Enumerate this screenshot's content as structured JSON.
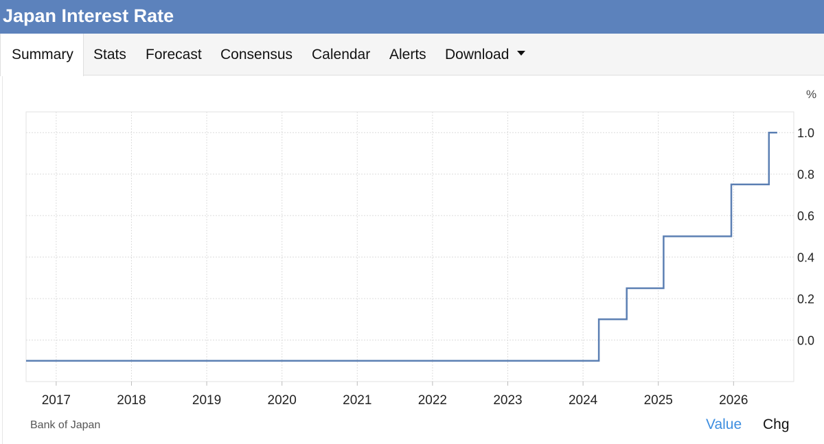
{
  "header": {
    "title": "Japan Interest Rate"
  },
  "tabs": [
    {
      "label": "Summary",
      "active": true
    },
    {
      "label": "Stats"
    },
    {
      "label": "Forecast"
    },
    {
      "label": "Consensus"
    },
    {
      "label": "Calendar"
    },
    {
      "label": "Alerts"
    },
    {
      "label": "Download",
      "dropdown": true
    }
  ],
  "footer": {
    "source": "Bank of Japan",
    "toggle_value": "Value",
    "toggle_chg": "Chg"
  },
  "colors": {
    "header_bg": "#5c82bc",
    "series_line": "#5b7fb3",
    "active_toggle": "#3d8ee0"
  },
  "chart_data": {
    "type": "line",
    "step": true,
    "unit": "%",
    "x_ticks": [
      "2017",
      "2018",
      "2019",
      "2020",
      "2021",
      "2022",
      "2023",
      "2024",
      "2025",
      "2026"
    ],
    "y_ticks": [
      "0.0",
      "0.2",
      "0.4",
      "0.6",
      "0.8",
      "1.0"
    ],
    "xlim": [
      2016.6,
      2026.8
    ],
    "ylim": [
      -0.2,
      1.1
    ],
    "grid": true,
    "y_axis_side": "right",
    "series": [
      {
        "points": [
          {
            "x": 2016.6,
            "y": -0.1
          },
          {
            "x": 2024.21,
            "y": 0.1
          },
          {
            "x": 2024.58,
            "y": 0.25
          },
          {
            "x": 2025.07,
            "y": 0.5
          },
          {
            "x": 2025.97,
            "y": 0.75
          },
          {
            "x": 2026.47,
            "y": 1.0
          },
          {
            "x": 2026.58,
            "y": 1.0
          }
        ]
      }
    ]
  }
}
